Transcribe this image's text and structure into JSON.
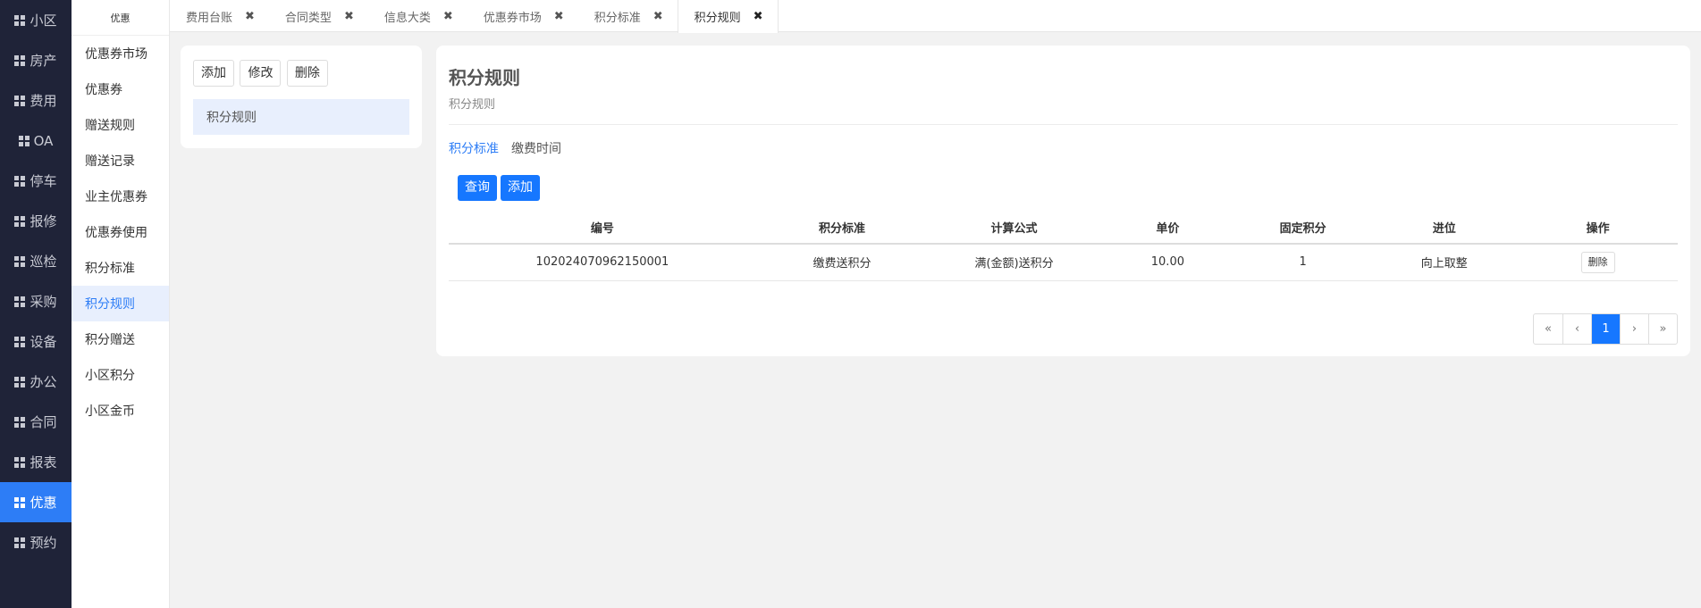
{
  "nav": {
    "items": [
      {
        "label": "小区"
      },
      {
        "label": "房产"
      },
      {
        "label": "费用"
      },
      {
        "label": "OA"
      },
      {
        "label": "停车"
      },
      {
        "label": "报修"
      },
      {
        "label": "巡检"
      },
      {
        "label": "采购"
      },
      {
        "label": "设备"
      },
      {
        "label": "办公"
      },
      {
        "label": "合同"
      },
      {
        "label": "报表"
      },
      {
        "label": "优惠",
        "active": true
      },
      {
        "label": "预约"
      }
    ]
  },
  "submenu": {
    "title": "优惠",
    "items": [
      {
        "label": "优惠券市场"
      },
      {
        "label": "优惠券"
      },
      {
        "label": "赠送规则"
      },
      {
        "label": "赠送记录"
      },
      {
        "label": "业主优惠券"
      },
      {
        "label": "优惠券使用"
      },
      {
        "label": "积分标准"
      },
      {
        "label": "积分规则",
        "active": true
      },
      {
        "label": "积分赠送"
      },
      {
        "label": "小区积分"
      },
      {
        "label": "小区金币"
      }
    ]
  },
  "tabs": [
    {
      "label": "费用台账"
    },
    {
      "label": "合同类型"
    },
    {
      "label": "信息大类"
    },
    {
      "label": "优惠券市场"
    },
    {
      "label": "积分标准"
    },
    {
      "label": "积分规则",
      "active": true
    }
  ],
  "tab_close_glyph": "✖",
  "left_card": {
    "buttons": {
      "add": "添加",
      "edit": "修改",
      "delete": "删除"
    },
    "selected_item": "积分规则"
  },
  "main": {
    "title": "积分规则",
    "subtitle": "积分规则",
    "inner_tabs": [
      {
        "label": "积分标准",
        "active": true
      },
      {
        "label": "缴费时间"
      }
    ],
    "buttons": {
      "query": "查询",
      "add": "添加"
    },
    "table": {
      "headers": [
        "编号",
        "积分标准",
        "计算公式",
        "单价",
        "固定积分",
        "进位",
        "操作"
      ],
      "rows": [
        {
          "id": "102024070962150001",
          "standard": "缴费送积分",
          "formula": "满(金额)送积分",
          "price": "10.00",
          "fixed": "1",
          "rounding": "向上取整",
          "action": "删除"
        }
      ]
    },
    "pagination": {
      "first": "«",
      "prev": "‹",
      "current": "1",
      "next": "›",
      "last": "»"
    }
  },
  "colors": {
    "accent": "#1677ff",
    "nav_bg": "#1f2338",
    "nav_active": "#2d7df6"
  }
}
